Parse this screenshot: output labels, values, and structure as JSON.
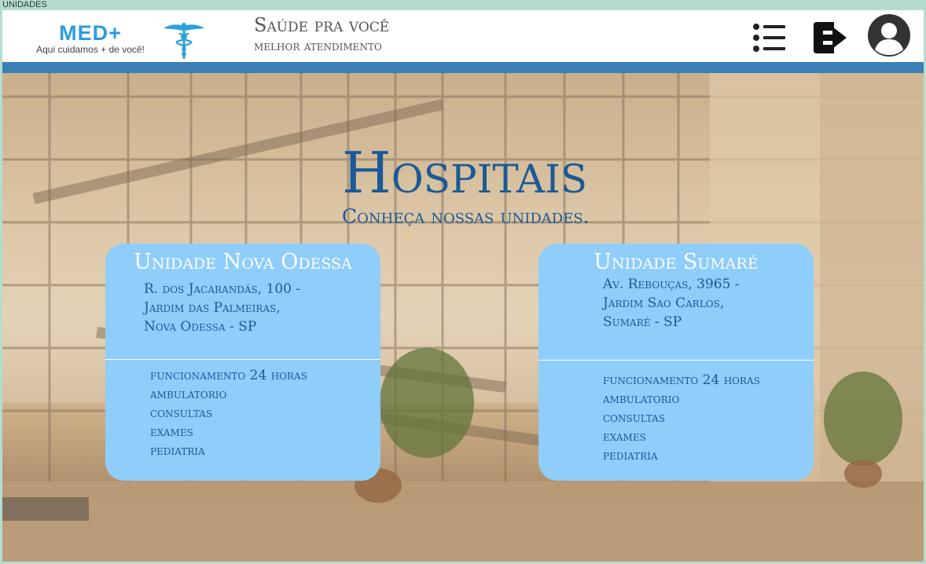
{
  "window": {
    "title": "UNIDADES"
  },
  "header": {
    "logo_word": "MED+",
    "logo_tagline": "Aqui cuidamos + de você!",
    "slogan_line1": "Saúde pra você",
    "slogan_line2": "melhor atendimento",
    "icons": {
      "menu": "menu-list-icon",
      "logout": "logout-icon",
      "avatar": "user-avatar-icon"
    }
  },
  "colors": {
    "brand_blue": "#2e9be0",
    "header_stripe": "#3a7fb5",
    "card_background": "#8fcdfb",
    "heading_blue": "#1a5a96"
  },
  "hero": {
    "title": "Hospitais",
    "subtitle": "Conheça nossas unidades."
  },
  "units": [
    {
      "name": "Unidade Nova Odessa",
      "address": [
        "R. dos Jacarandás, 100 -",
        "Jardim das Palmeiras,",
        "Nova Odessa - SP"
      ],
      "services": [
        "funcionamento 24 horas",
        "ambulatorio",
        "consultas",
        "exames",
        "pediatria"
      ]
    },
    {
      "name": "Unidade Sumaré",
      "address": [
        "Av. Rebouças, 3965 -",
        "Jardim Sao Carlos,",
        "Sumaré - SP"
      ],
      "services": [
        "funcionamento 24 horas",
        "ambulatorio",
        "consultas",
        "exames",
        "pediatria"
      ]
    }
  ]
}
